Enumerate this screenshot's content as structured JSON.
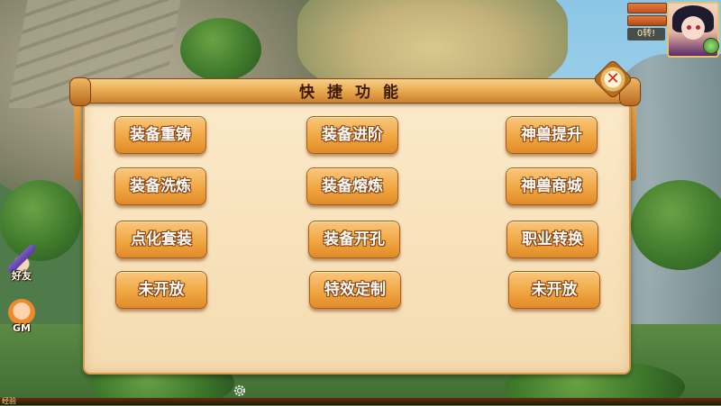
{
  "panel": {
    "title": "快捷功能",
    "buttons": [
      [
        "装备重铸",
        "装备进阶",
        "神兽提升"
      ],
      [
        "装备洗炼",
        "装备熔炼",
        "神兽商城"
      ],
      [
        "点化套装",
        "装备开孔",
        "职业转换"
      ],
      [
        "未开放",
        "特效定制",
        "未开放"
      ]
    ],
    "close_icon": "close-x-icon"
  },
  "hud": {
    "rebirth_text": "0转!",
    "portrait_icon": "character-portrait"
  },
  "side_buttons": {
    "friends_label": "好友",
    "gm_label": "GM"
  },
  "bottom": {
    "xp_label": "经验",
    "settings_icon": "gear-icon"
  },
  "colors": {
    "button_fill": "#f0a743",
    "panel_bg": "#fbe9c8",
    "title_text": "#3c1a05",
    "close_x": "#d22b1f"
  }
}
